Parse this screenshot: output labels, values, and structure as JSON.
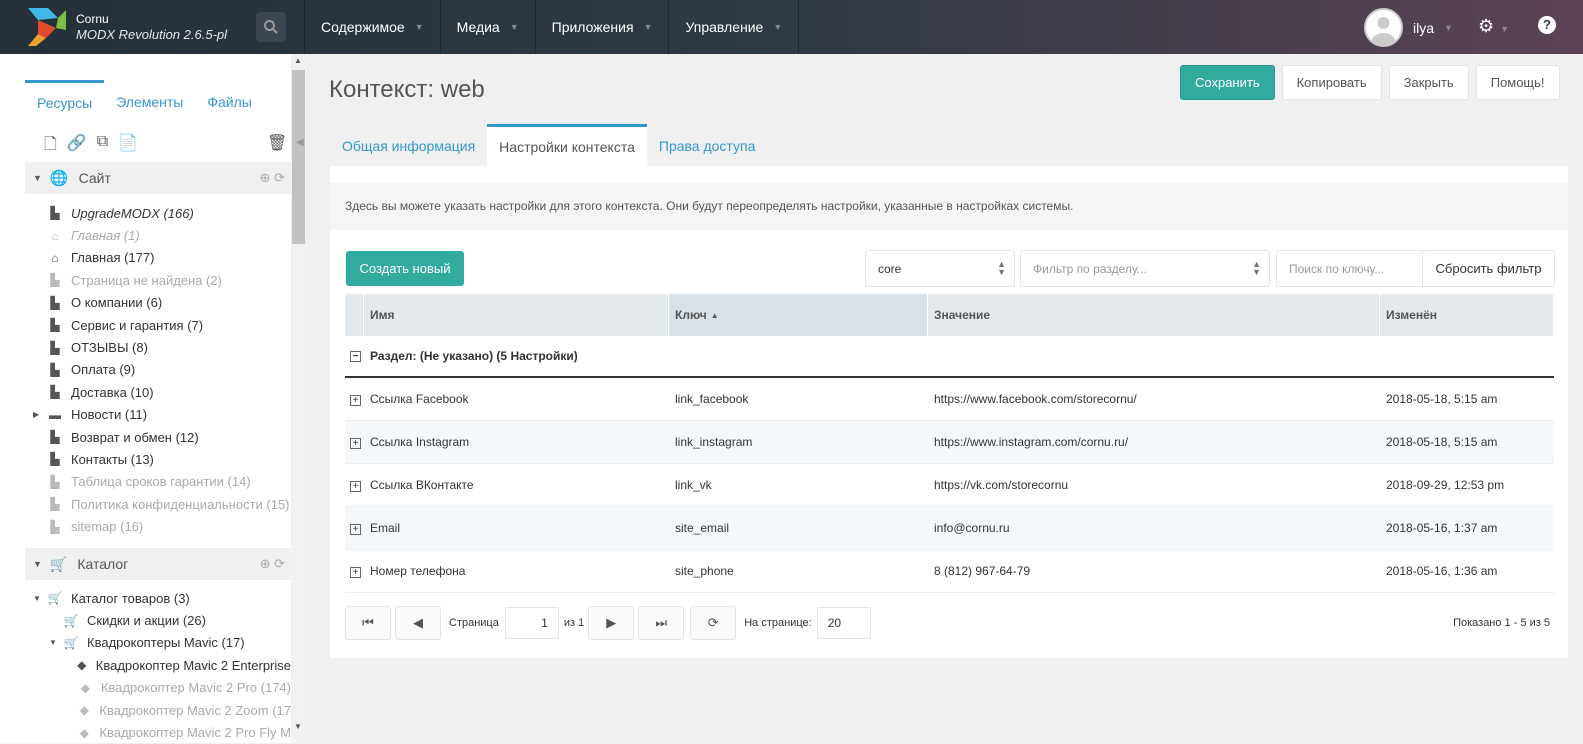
{
  "header": {
    "app_name": "Cornu",
    "version": "MODX Revolution 2.6.5-pl",
    "nav": [
      {
        "label": "Содержимое"
      },
      {
        "label": "Медиа"
      },
      {
        "label": "Приложения"
      },
      {
        "label": "Управление"
      }
    ],
    "user": "ilya",
    "help": "?"
  },
  "sidebar": {
    "tabs": [
      {
        "label": "Ресурсы"
      },
      {
        "label": "Элементы"
      },
      {
        "label": "Файлы"
      }
    ],
    "site_section": "Сайт",
    "site_items": [
      {
        "label": "UpgradeMODX (166)",
        "icon": "file-icon",
        "style": "italic"
      },
      {
        "label": "Главная (1)",
        "icon": "home-icon",
        "style": "faded-italic"
      },
      {
        "label": "Главная (177)",
        "icon": "home-icon",
        "style": "normal"
      },
      {
        "label": "Страница не найдена (2)",
        "icon": "file-icon",
        "style": "faded"
      },
      {
        "label": "О компании (6)",
        "icon": "file-icon",
        "style": "normal"
      },
      {
        "label": "Сервис и гарантия (7)",
        "icon": "file-icon",
        "style": "normal"
      },
      {
        "label": "ОТЗЫВЫ (8)",
        "icon": "file-icon",
        "style": "normal"
      },
      {
        "label": "Оплата (9)",
        "icon": "file-icon",
        "style": "normal"
      },
      {
        "label": "Доставка (10)",
        "icon": "file-icon",
        "style": "normal"
      },
      {
        "label": "Новости (11)",
        "icon": "folder-icon",
        "style": "normal"
      },
      {
        "label": "Возврат и обмен (12)",
        "icon": "file-icon",
        "style": "normal"
      },
      {
        "label": "Контакты (13)",
        "icon": "file-icon",
        "style": "normal"
      },
      {
        "label": "Таблица сроков гарантии (14)",
        "icon": "file-icon",
        "style": "faded"
      },
      {
        "label": "Политика конфиденциальности (15)",
        "icon": "file-icon",
        "style": "faded"
      },
      {
        "label": "sitemap (16)",
        "icon": "file-icon",
        "style": "faded"
      }
    ],
    "catalog_section": "Каталог",
    "catalog_items": [
      {
        "label": "Каталог товаров (3)",
        "icon": "cart-icon",
        "style": "normal"
      },
      {
        "label": "Скидки и акции (26)",
        "icon": "cart-icon",
        "style": "normal"
      },
      {
        "label": "Квадрокоптеры Mavic (17)",
        "icon": "cart-icon",
        "style": "normal"
      },
      {
        "label": "Квадрокоптер Mavic 2 Enterprise",
        "icon": "tag-icon",
        "style": "normal"
      },
      {
        "label": "Квадрокоптер Mavic 2 Pro (174)",
        "icon": "tag-icon",
        "style": "faded"
      },
      {
        "label": "Квадрокоптер Mavic 2 Zoom (17",
        "icon": "tag-icon",
        "style": "faded"
      },
      {
        "label": "Квадрокоптер Mavic 2 Pro Fly M",
        "icon": "tag-icon",
        "style": "faded"
      }
    ]
  },
  "page": {
    "title": "Контекст: web",
    "buttons": {
      "save": "Сохранить",
      "copy": "Копировать",
      "close": "Закрыть",
      "help": "Помощь!"
    },
    "tabs": [
      {
        "label": "Общая информация"
      },
      {
        "label": "Настройки контекста"
      },
      {
        "label": "Права доступа"
      }
    ],
    "description": "Здесь вы можете указать настройки для этого контекста. Они будут переопределять настройки, указанные в настройках системы.",
    "create_btn": "Создать новый",
    "namespace_value": "core",
    "area_placeholder": "Фильтр по разделу...",
    "key_placeholder": "Поиск по ключу...",
    "reset_btn": "Сбросить фильтр",
    "columns": {
      "name": "Имя",
      "key": "Ключ",
      "value": "Значение",
      "edited": "Изменён"
    },
    "group_label": "Раздел: (Не указано) (5 Настройки)",
    "rows": [
      {
        "name": "Ссылка Facebook",
        "key": "link_facebook",
        "value": "https://www.facebook.com/storecornu/",
        "edited": "2018-05-18, 5:15 am"
      },
      {
        "name": "Ссылка Instagram",
        "key": "link_instagram",
        "value": "https://www.instagram.com/cornu.ru/",
        "edited": "2018-05-18, 5:15 am"
      },
      {
        "name": "Ссылка ВКонтакте",
        "key": "link_vk",
        "value": "https://vk.com/storecornu",
        "edited": "2018-09-29, 12:53 pm"
      },
      {
        "name": "Email",
        "key": "site_email",
        "value": "info@cornu.ru",
        "edited": "2018-05-16, 1:37 am"
      },
      {
        "name": "Номер телефона",
        "key": "site_phone",
        "value": "8 (812) 967-64-79",
        "edited": "2018-05-16, 1:36 am"
      }
    ],
    "pager": {
      "page_label": "Страница",
      "page": "1",
      "of": "из 1",
      "per_page_label": "На странице:",
      "per_page": "20",
      "shown": "Показано 1 - 5 из 5"
    }
  },
  "colors": {
    "accent": "#3697cd",
    "primary": "#32ab9f"
  }
}
